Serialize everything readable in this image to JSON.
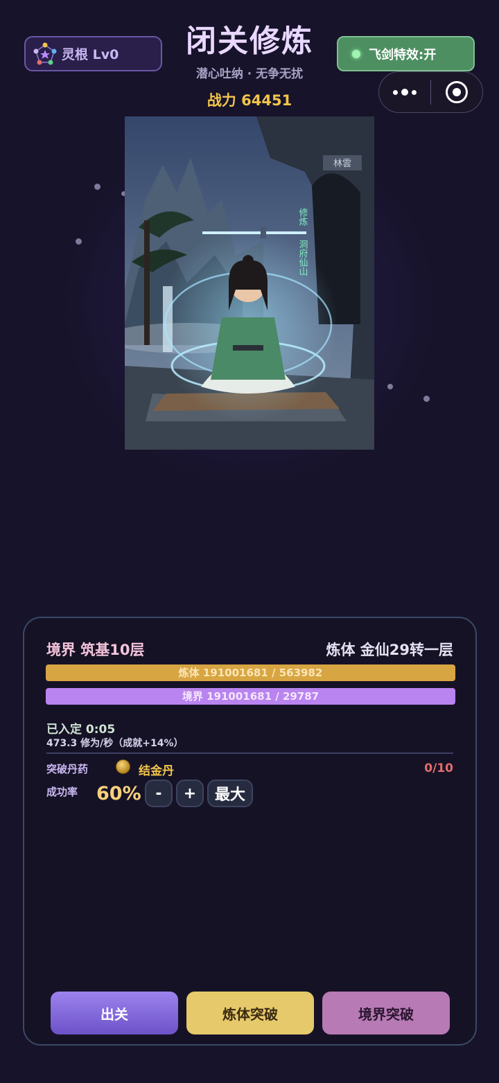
{
  "header": {
    "root_label": "灵根 Lv0",
    "title": "闭关修炼",
    "subtitle": "潜心吐纳 · 无争无扰",
    "power": "战力 64451",
    "fx_toggle_label": "飞剑特效:开"
  },
  "artwork": {
    "plaque_top": "林雲",
    "banner_left": "修炼",
    "banner_right": "洞府仙山"
  },
  "panel": {
    "realm": "境界 筑基10层",
    "body": "炼体 金仙29转一层",
    "body_bar_text": "炼体 191001681 / 563982",
    "body_bar_progress": 1.0,
    "realm_bar_text": "境界 191001681 / 29787",
    "realm_bar_progress": 1.0,
    "seclusion_time": "已入定 0:05",
    "cultivation_rate": "473.3 修为/秒（成就+14%）",
    "pill_label": "突破丹药",
    "pill_name": "结金丹",
    "pill_count": "0/10",
    "success_label": "成功率",
    "success_value": "60%",
    "minus_label": "-",
    "plus_label": "+",
    "max_label": "最大"
  },
  "actions": {
    "leave": "出关",
    "body_breakthrough": "炼体突破",
    "realm_breakthrough": "境界突破"
  },
  "colors": {
    "background": "#17132a",
    "gold": "#d8a543",
    "purple": "#b984ef",
    "toggle_green": "#4e8f62",
    "danger": "#e36d6d"
  }
}
